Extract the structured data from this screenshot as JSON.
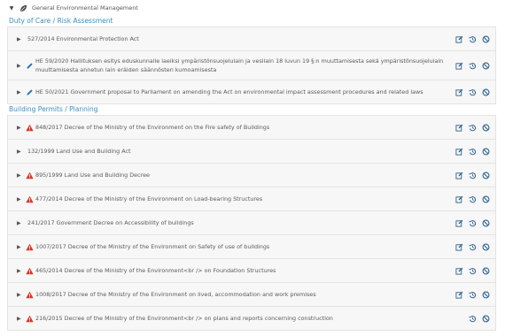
{
  "tree": {
    "root_label": "General Environmental Management"
  },
  "sections": [
    {
      "title": "Duty of Care / Risk Assessment",
      "rows": [
        {
          "indicator": "none",
          "title": "527/2014 Environmental Protection Act",
          "has_edit": true
        },
        {
          "indicator": "pencil",
          "title": "HE 59/2020 Hallituksen esitys eduskunnalle laeiksi ympäristönsuojelulain ja vesilain 18 luvun 19 §:n muuttamisesta sekä ympäristönsuojelulain muuttamisesta annetun lain eräiden säännösten kumoamisesta",
          "has_edit": true
        },
        {
          "indicator": "pencil",
          "title": "HE 50/2021 Government proposal to Parliament on amending the Act on environmental impact assessment procedures and related laws",
          "has_edit": true
        }
      ]
    },
    {
      "title": "Building Permits / Planning",
      "rows": [
        {
          "indicator": "warning",
          "title": "848/2017 Decree of the Ministry of the Environment on the Fire safety of Buildings",
          "has_edit": true
        },
        {
          "indicator": "none",
          "title": "132/1999 Land Use and Building Act",
          "has_edit": true
        },
        {
          "indicator": "warning",
          "title": "895/1999 Land Use and Building Decree",
          "has_edit": true
        },
        {
          "indicator": "warning",
          "title": "477/2014 Decree of the Ministry of the Environment on Load-bearing Structures",
          "has_edit": true
        },
        {
          "indicator": "none",
          "title": "241/2017 Government Decree on Accessibility of buildings",
          "has_edit": true
        },
        {
          "indicator": "warning",
          "title": "1007/2017 Decree of the Ministry of the Environment on Safety of use of buildings",
          "has_edit": true
        },
        {
          "indicator": "warning",
          "title": "465/2014 Decree of the Ministry of the Environment<br /> on Foundation Structures",
          "has_edit": true
        },
        {
          "indicator": "warning",
          "title": "1008/2017 Decree of the Ministry of the Environment on lived, accommodation and work premises",
          "has_edit": true
        },
        {
          "indicator": "warning",
          "title": "216/2015 Decree of the Ministry of the Environment<br /> on plans and reports concerning construction",
          "has_edit": false
        }
      ]
    }
  ],
  "colors": {
    "accent": "#3a8fc4",
    "warning": "#d9342b",
    "icon": "#2b5f8f",
    "row_bg": "#f7f7f7"
  }
}
